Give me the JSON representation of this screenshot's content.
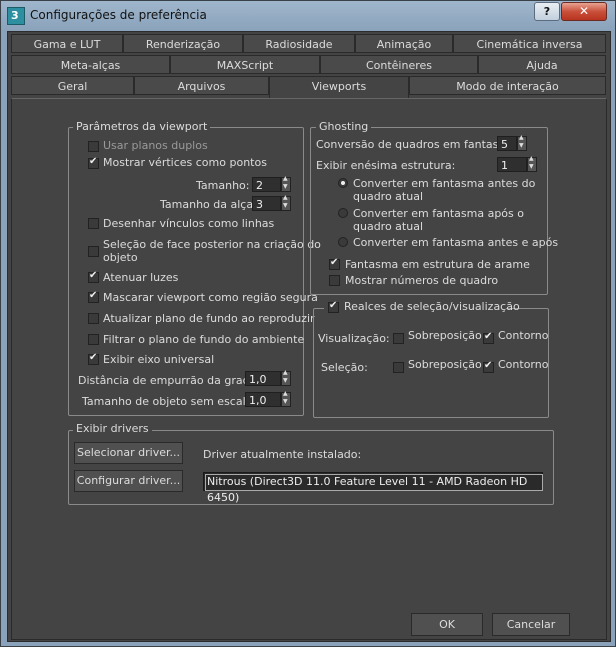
{
  "window": {
    "title": "Configurações de preferência",
    "help_label": "?",
    "close_label": "✕"
  },
  "tabs": {
    "row1": [
      "Gama e LUT",
      "Renderização",
      "Radiosidade",
      "Animação",
      "Cinemática inversa"
    ],
    "row2": [
      "Meta-alças",
      "MAXScript",
      "Contêineres",
      "Ajuda"
    ],
    "row3": [
      "Geral",
      "Arquivos",
      "Viewports",
      "Modo de interação"
    ],
    "active": "Viewports"
  },
  "viewport_params": {
    "title": "Parâmetros da viewport",
    "use_dual_planes": {
      "label": "Usar planos duplos",
      "checked": false
    },
    "show_vertices_as_dots": {
      "label": "Mostrar vértices como pontos",
      "checked": true
    },
    "size": {
      "label": "Tamanho:",
      "value": "2"
    },
    "handle_size": {
      "label": "Tamanho da alça:",
      "value": "3"
    },
    "draw_links_as_lines": {
      "label": "Desenhar vínculos como linhas",
      "checked": false
    },
    "backface_selection": {
      "label1": "Seleção de face posterior na criação do",
      "label2": "objeto",
      "checked": false
    },
    "attenuate_lights": {
      "label": "Atenuar luzes",
      "checked": true
    },
    "mask_viewport": {
      "label": "Mascarar viewport como região segura",
      "checked": true
    },
    "update_bg_on_play": {
      "label": "Atualizar plano de fundo ao reproduzir",
      "checked": false
    },
    "filter_env_bg": {
      "label": "Filtrar o plano de fundo do ambiente",
      "checked": false
    },
    "show_world_axis": {
      "label": "Exibir eixo universal",
      "checked": true
    },
    "grid_nudge": {
      "label": "Distância de empurrão da grade:",
      "value": "1,0"
    },
    "unscaled_size": {
      "label": "Tamanho de objeto sem escala:",
      "value": "1,0"
    }
  },
  "ghosting": {
    "title": "Ghosting",
    "ghost_frames": {
      "label": "Conversão de quadros em fantasma:",
      "value": "5"
    },
    "nth_frame": {
      "label": "Exibir enésima estrutura:",
      "value": "1"
    },
    "options": [
      {
        "label1": "Converter em fantasma antes do",
        "label2": "quadro atual",
        "selected": true
      },
      {
        "label1": "Converter em fantasma após o",
        "label2": "quadro atual",
        "selected": false
      },
      {
        "label1": "Converter em fantasma antes e após",
        "label2": "",
        "selected": false
      }
    ],
    "wireframe": {
      "label": "Fantasma em estrutura de arame",
      "checked": true
    },
    "frame_numbers": {
      "label": "Mostrar números de quadro",
      "checked": false
    }
  },
  "highlights": {
    "title": "Realces de seleção/visualização",
    "checked": true,
    "rows": [
      {
        "label": "Visualização:",
        "overlay_label": "Sobreposição",
        "overlay": false,
        "outline_label": "Contorno",
        "outline": true
      },
      {
        "label": "Seleção:",
        "overlay_label": "Sobreposição",
        "overlay": false,
        "outline_label": "Contorno",
        "outline": true
      }
    ]
  },
  "drivers": {
    "title": "Exibir drivers",
    "select_label": "Selecionar driver...",
    "configure_label": "Configurar driver...",
    "installed_label": "Driver atualmente instalado:",
    "installed_value": "Nitrous (Direct3D 11.0 Feature Level 11 - AMD Radeon HD 6450)"
  },
  "footer": {
    "ok_label": "OK",
    "cancel_label": "Cancelar"
  }
}
